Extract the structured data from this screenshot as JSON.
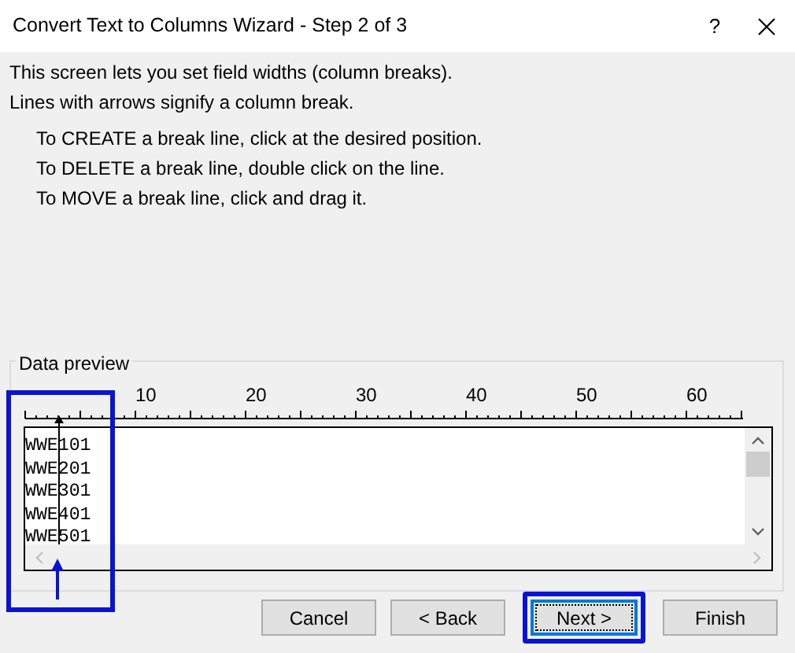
{
  "window": {
    "title": "Convert Text to Columns Wizard - Step 2 of 3",
    "help": "?"
  },
  "intro": [
    "This screen lets you set field widths (column breaks).",
    "Lines with arrows signify a column break."
  ],
  "instructions": [
    "To CREATE a break line, click at the desired position.",
    "To DELETE a break line, double click on the line.",
    "To MOVE a break line, click and drag it."
  ],
  "preview": {
    "label": "Data preview",
    "ruler_labels": [
      "10",
      "20",
      "30",
      "40",
      "50",
      "60"
    ],
    "rows": [
      "WWE101",
      "WWE201",
      "WWE301",
      "WWE401",
      "WWE501"
    ]
  },
  "buttons": [
    {
      "label": "Cancel",
      "default": false
    },
    {
      "label": "< Back",
      "default": false
    },
    {
      "label": "Next >",
      "default": true
    },
    {
      "label": "Finish",
      "default": false
    }
  ]
}
